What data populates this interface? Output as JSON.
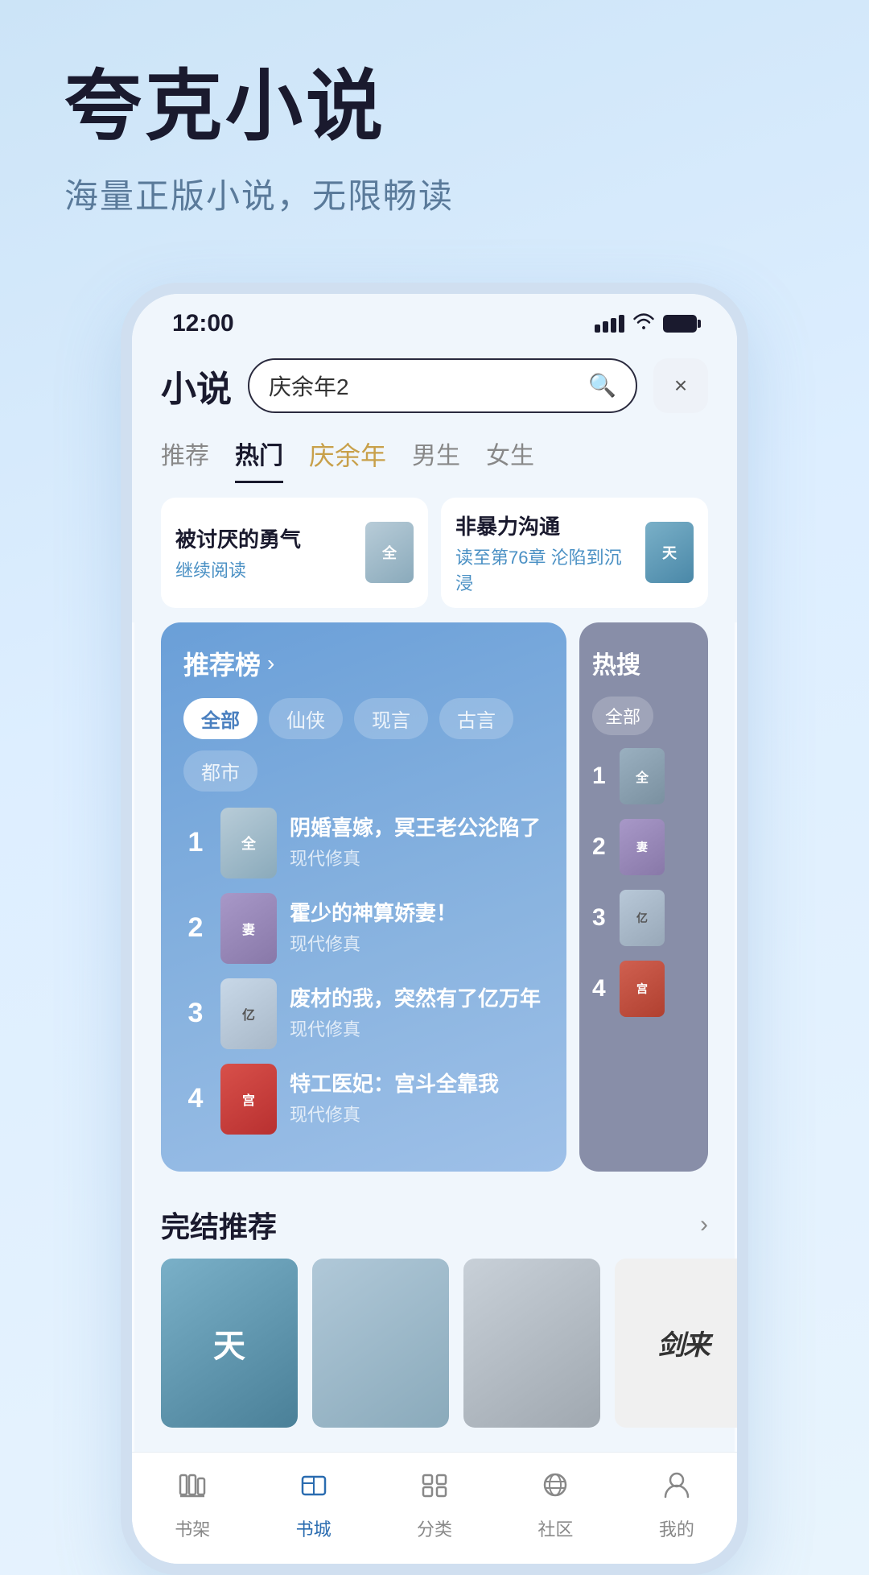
{
  "hero": {
    "title": "夸克小说",
    "subtitle": "海量正版小说，无限畅读"
  },
  "status_bar": {
    "time": "12:00",
    "signal_label": "signal",
    "wifi_label": "wifi",
    "battery_label": "battery"
  },
  "header": {
    "app_title": "小说",
    "search_placeholder": "庆余年2",
    "close_label": "×"
  },
  "tabs": [
    {
      "label": "推荐",
      "active": false,
      "special": false
    },
    {
      "label": "热门",
      "active": true,
      "special": false
    },
    {
      "label": "庆余年",
      "active": false,
      "special": true
    },
    {
      "label": "男生",
      "active": false,
      "special": false
    },
    {
      "label": "女生",
      "active": false,
      "special": false
    }
  ],
  "reading_continue": [
    {
      "title": "被讨厌的勇气",
      "action": "继续阅读"
    },
    {
      "title": "非暴力沟通",
      "action": "读至第76章 沦陷到沉浸"
    }
  ],
  "rec_panel": {
    "title": "推荐榜",
    "arrow": "›",
    "filters": [
      "全部",
      "仙侠",
      "现言",
      "古言",
      "都市"
    ],
    "active_filter": "全部",
    "books": [
      {
        "rank": "1",
        "title": "阴婚喜嫁，冥王老公沦陷了",
        "genre": "现代修真"
      },
      {
        "rank": "2",
        "title": "霍少的神算娇妻！",
        "genre": "现代修真"
      },
      {
        "rank": "3",
        "title": "废材的我，突然有了亿万年",
        "genre": "现代修真"
      },
      {
        "rank": "4",
        "title": "特工医妃：宫斗全靠我",
        "genre": "现代修真"
      }
    ]
  },
  "hot_panel": {
    "title": "热搜",
    "filter": "全部",
    "items": [
      "1",
      "2",
      "3",
      "4"
    ]
  },
  "completed_section": {
    "title": "完结推荐",
    "arrow": "›",
    "books": [
      {
        "label": "天",
        "style": "1"
      },
      {
        "label": "",
        "style": "2"
      },
      {
        "label": "",
        "style": "3"
      },
      {
        "label": "剑来",
        "style": "4"
      }
    ]
  },
  "bottom_nav": [
    {
      "label": "书架",
      "icon": "📚",
      "active": false
    },
    {
      "label": "书城",
      "icon": "📖",
      "active": true
    },
    {
      "label": "分类",
      "icon": "⠿",
      "active": false
    },
    {
      "label": "社区",
      "icon": "🌐",
      "active": false
    },
    {
      "label": "我的",
      "icon": "👤",
      "active": false
    }
  ]
}
